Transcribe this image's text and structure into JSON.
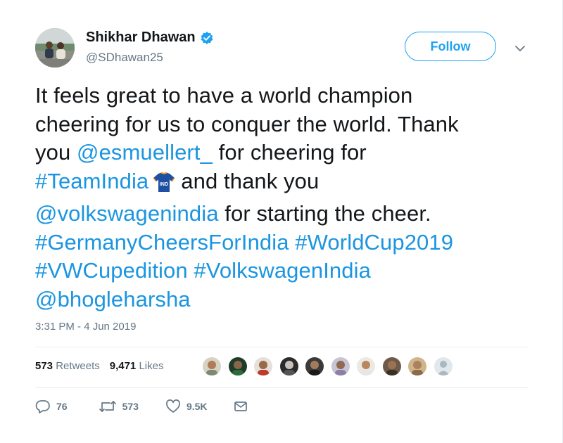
{
  "author": {
    "name": "Shikhar Dhawan",
    "handle": "@SDhawan25",
    "avatar_icon": "profile-photo",
    "verified_icon": "verified-badge-icon"
  },
  "header": {
    "follow_label": "Follow",
    "menu_icon": "chevron-down-icon"
  },
  "tweet": {
    "line1": "It feels great to have a world champion",
    "line2": "cheering for us to conquer the world. Thank",
    "line3_pre": "you ",
    "line3_link": "@esmuellert_",
    "line3_post": " for cheering for",
    "line4_link": "#TeamIndia",
    "line4_emoji": "india-cricket-jersey-emoji",
    "line4_post": "and thank you",
    "line5_link": "@volkswagenindia",
    "line5_post": " for starting the cheer.",
    "line6_link1": "#GermanyCheersForIndia",
    "line6_link2": "#WorldCup2019",
    "line7_link1": "#VWCupedition",
    "line7_link2": "#VolkswagenIndia",
    "line8_link": "@bhogleharsha",
    "jersey_text": "IND"
  },
  "timestamp": "3:31 PM - 4 Jun 2019",
  "stats": {
    "retweets_count": "573",
    "retweets_label": "Retweets",
    "likes_count": "9,471",
    "likes_label": "Likes"
  },
  "likers": [
    {
      "icon": "liker-avatar-1"
    },
    {
      "icon": "liker-avatar-2"
    },
    {
      "icon": "liker-avatar-3"
    },
    {
      "icon": "liker-avatar-4"
    },
    {
      "icon": "liker-avatar-5"
    },
    {
      "icon": "liker-avatar-6"
    },
    {
      "icon": "liker-avatar-7"
    },
    {
      "icon": "liker-avatar-8"
    },
    {
      "icon": "default-avatar-icon"
    }
  ],
  "actions": {
    "reply_count": "76",
    "retweet_count": "573",
    "like_count": "9.5K"
  },
  "colors": {
    "accent": "#1da1f2",
    "link": "#1b95e0",
    "text": "#14171a",
    "muted": "#657786",
    "divider": "#e6ecf0"
  }
}
